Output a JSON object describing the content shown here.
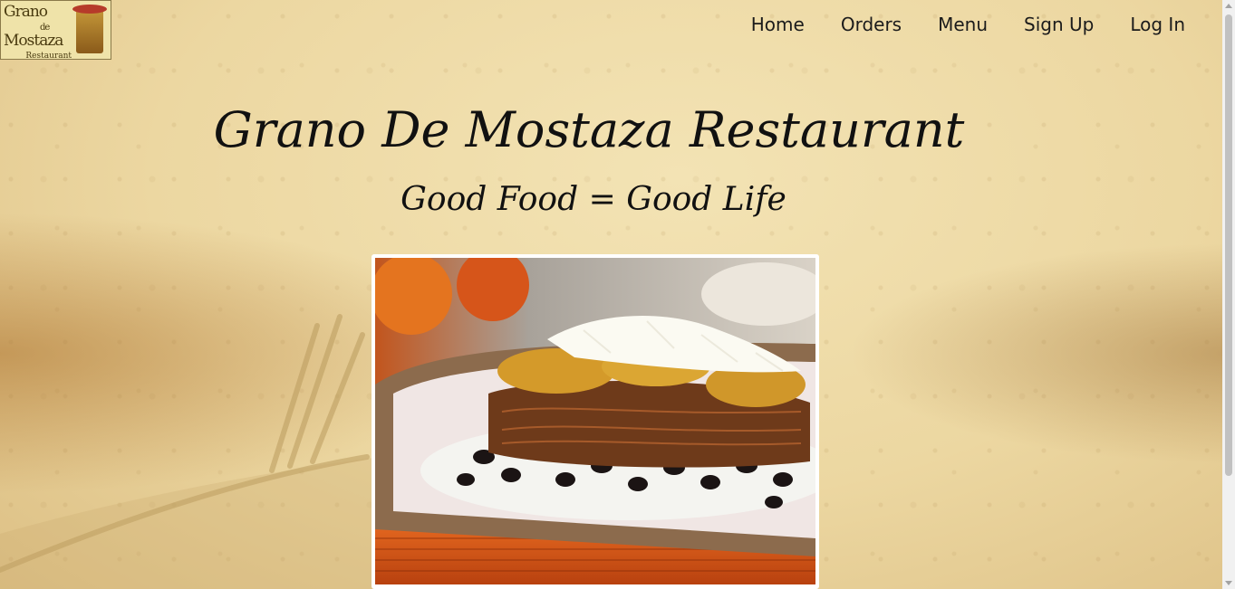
{
  "logo": {
    "line1": "Grano",
    "line2": "de",
    "line3": "Mostaza",
    "tagline": "Restaurant"
  },
  "nav": {
    "items": [
      {
        "label": "Home"
      },
      {
        "label": "Orders"
      },
      {
        "label": "Menu"
      },
      {
        "label": "Sign Up"
      },
      {
        "label": "Log In"
      }
    ]
  },
  "hero": {
    "title": "Grano De Mostaza Restaurant",
    "subtitle": "Good Food = Good Life"
  },
  "colors": {
    "background": "#ecd7a1",
    "text": "#111111"
  }
}
